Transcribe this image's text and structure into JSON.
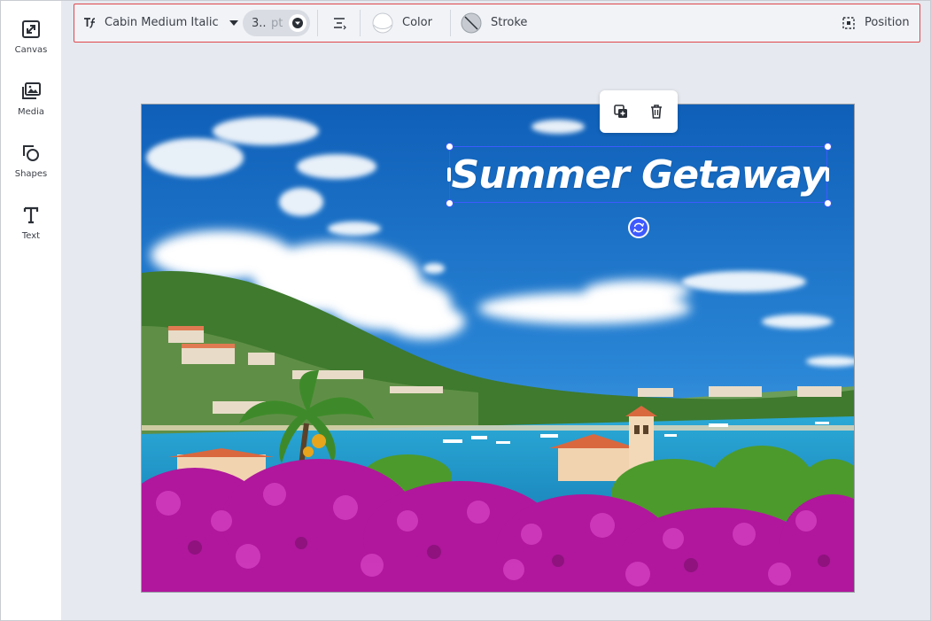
{
  "sidebar": {
    "items": [
      {
        "label": "Canvas",
        "icon": "expand-icon"
      },
      {
        "label": "Media",
        "icon": "media-icon"
      },
      {
        "label": "Shapes",
        "icon": "shapes-icon"
      },
      {
        "label": "Text",
        "icon": "text-icon"
      }
    ]
  },
  "toolbar": {
    "font_name": "Cabin Medium Italic",
    "font_size_value": "3..",
    "font_size_unit": "pt",
    "color_label": "Color",
    "stroke_label": "Stroke",
    "position_label": "Position"
  },
  "canvas": {
    "text_element": "Summer Getaway"
  },
  "colors": {
    "selection": "#3d5afe",
    "toolbar_highlight": "#e0474c",
    "sky": "#1a74c9",
    "flowers": "#b0179c"
  }
}
